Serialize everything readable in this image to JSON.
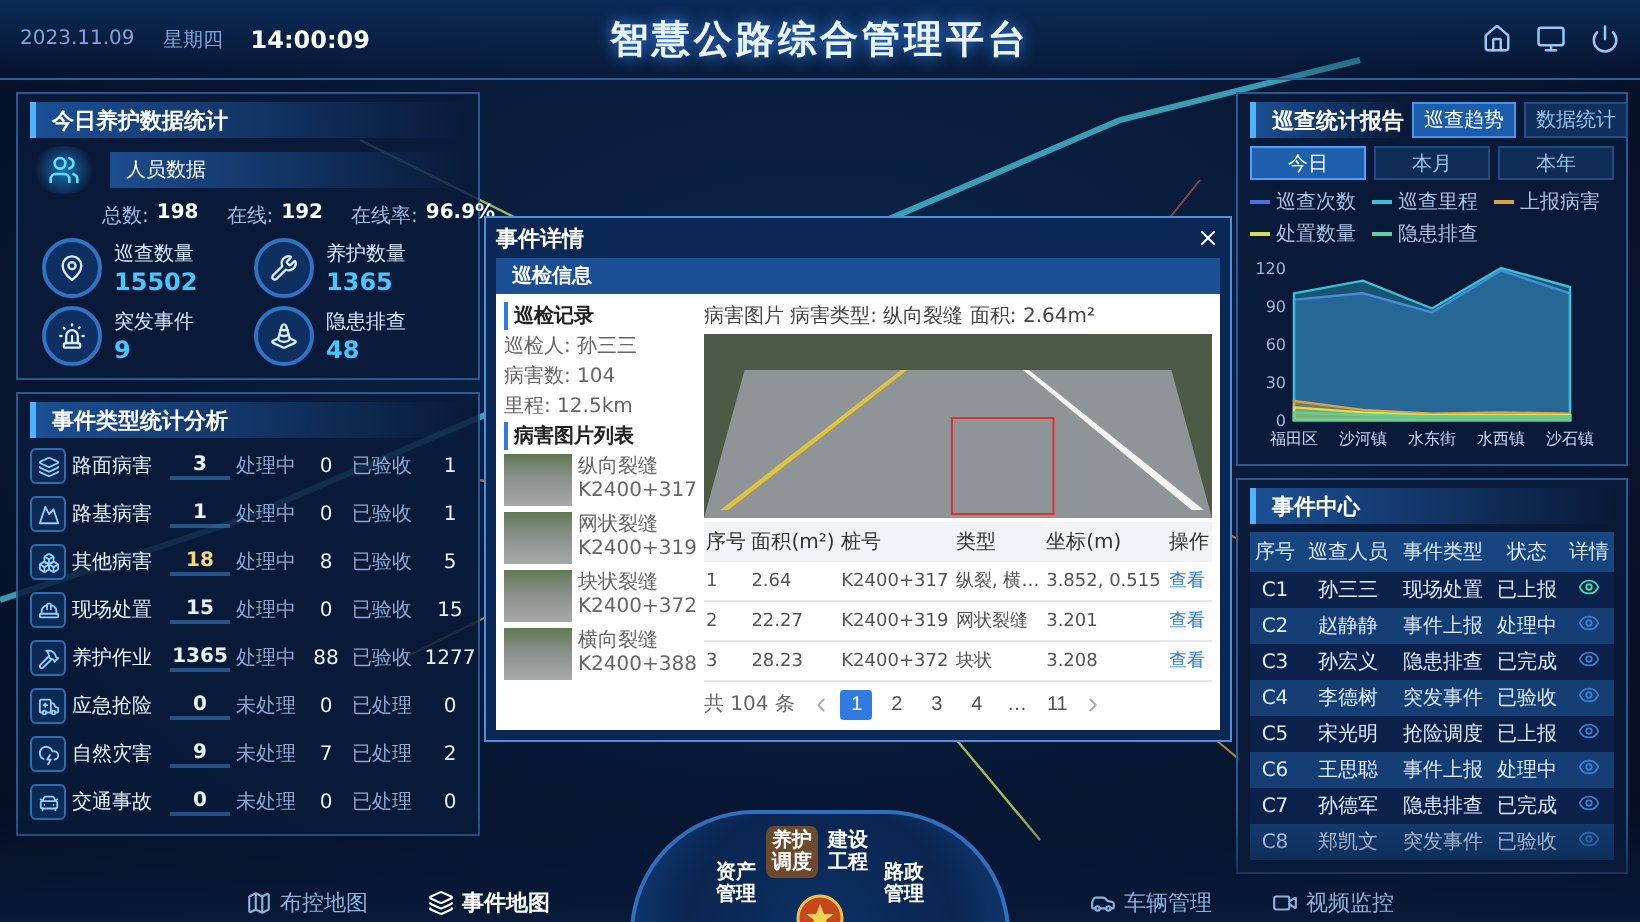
{
  "header": {
    "date": "2023.11.09",
    "weekday": "星期四",
    "time": "14:00:09",
    "title": "智慧公路综合管理平台"
  },
  "daily_stats": {
    "title": "今日养护数据统计",
    "personnel": {
      "label": "人员数据",
      "stats": [
        {
          "label": "总数:",
          "value": "198"
        },
        {
          "label": "在线:",
          "value": "192"
        },
        {
          "label": "在线率:",
          "value": "96.9%"
        }
      ]
    },
    "metrics": [
      {
        "kind": "patrol",
        "label": "巡查数量",
        "value": "15502"
      },
      {
        "kind": "maintenance",
        "label": "养护数量",
        "value": "1365"
      },
      {
        "kind": "incident",
        "label": "突发事件",
        "value": "9"
      },
      {
        "kind": "hazard",
        "label": "隐患排查",
        "value": "48"
      }
    ]
  },
  "event_types": {
    "title": "事件类型统计分析",
    "rows": [
      {
        "kind": "pavement",
        "name": "路面病害",
        "count": "3",
        "pending_label": "处理中",
        "pending": "0",
        "done_label": "已验收",
        "done": "1"
      },
      {
        "kind": "subgrade",
        "name": "路基病害",
        "count": "1",
        "pending_label": "处理中",
        "pending": "0",
        "done_label": "已验收",
        "done": "1"
      },
      {
        "kind": "other",
        "name": "其他病害",
        "count": "18",
        "pending_label": "处理中",
        "pending": "8",
        "done_label": "已验收",
        "done": "5"
      },
      {
        "kind": "onsite",
        "name": "现场处置",
        "count": "15",
        "pending_label": "处理中",
        "pending": "0",
        "done_label": "已验收",
        "done": "15"
      },
      {
        "kind": "maintenance",
        "name": "养护作业",
        "count": "1365",
        "pending_label": "处理中",
        "pending": "88",
        "done_label": "已验收",
        "done": "1277"
      },
      {
        "kind": "emergency",
        "name": "应急抢险",
        "count": "0",
        "pending_label": "未处理",
        "pending": "0",
        "done_label": "已处理",
        "done": "0"
      },
      {
        "kind": "disaster",
        "name": "自然灾害",
        "count": "9",
        "pending_label": "未处理",
        "pending": "7",
        "done_label": "已处理",
        "done": "2"
      },
      {
        "kind": "accident",
        "name": "交通事故",
        "count": "0",
        "pending_label": "未处理",
        "pending": "0",
        "done_label": "已处理",
        "done": "0"
      }
    ]
  },
  "modal": {
    "title": "事件详情",
    "tab": "巡检信息",
    "info_title": "巡检记录",
    "info": [
      "巡检人: 孙三三",
      "病害数: 104",
      "里程: 12.5km"
    ],
    "list_title": "病害图片列表",
    "thumbnails": [
      {
        "type": "纵向裂缝",
        "station": "K2400+317"
      },
      {
        "type": "网状裂缝",
        "station": "K2400+319"
      },
      {
        "type": "块状裂缝",
        "station": "K2400+372"
      },
      {
        "type": "横向裂缝",
        "station": "K2400+388"
      }
    ],
    "caption": "病害图片  病害类型: 纵向裂缝  面积: 2.64m²",
    "table": {
      "columns": [
        "序号",
        "面积(m²)",
        "桩号",
        "类型",
        "坐标(m)",
        "操作"
      ],
      "rows": [
        [
          "1",
          "2.64",
          "K2400+317",
          "纵裂, 横…",
          "3.852, 0.515",
          "查看"
        ],
        [
          "2",
          "22.27",
          "K2400+319",
          "网状裂缝",
          "3.201",
          "查看"
        ],
        [
          "3",
          "28.23",
          "K2400+372",
          "块状",
          "3.208",
          "查看"
        ]
      ]
    },
    "pagination": {
      "total": "共 104 条",
      "pages": [
        {
          "label": "1",
          "selected": true
        },
        {
          "label": "2",
          "selected": false
        },
        {
          "label": "3",
          "selected": false
        },
        {
          "label": "4",
          "selected": false
        },
        {
          "label": "…",
          "selected": false
        },
        {
          "label": "11",
          "selected": false
        }
      ]
    }
  },
  "patrol_report": {
    "title": "巡查统计报告",
    "buttons": [
      {
        "label": "巡查趋势",
        "selected": true
      },
      {
        "label": "数据统计",
        "selected": false
      }
    ],
    "tabs": [
      {
        "label": "今日",
        "selected": true
      },
      {
        "label": "本月",
        "selected": false
      },
      {
        "label": "本年",
        "selected": false
      }
    ],
    "chart_data": {
      "type": "area",
      "categories": [
        "福田区",
        "沙河镇",
        "水东街",
        "水西镇",
        "沙石镇"
      ],
      "ylim": [
        0,
        120
      ],
      "yticks": [
        0,
        30,
        60,
        90,
        120
      ],
      "series": [
        {
          "name": "巡查次数",
          "color": "#4a6fe0",
          "values": [
            95,
            100,
            85,
            118,
            100
          ]
        },
        {
          "name": "巡查里程",
          "color": "#36c2d8",
          "values": [
            100,
            110,
            88,
            120,
            105
          ]
        },
        {
          "name": "上报病害",
          "color": "#e0a040",
          "values": [
            15,
            8,
            5,
            6,
            5
          ]
        },
        {
          "name": "处置数量",
          "color": "#d8e04a",
          "values": [
            10,
            6,
            4,
            4,
            4
          ]
        },
        {
          "name": "隐患排查",
          "color": "#5fd0a0",
          "values": [
            6,
            4,
            3,
            3,
            3
          ]
        }
      ]
    }
  },
  "event_center": {
    "title": "事件中心",
    "columns": [
      "序号",
      "巡查人员",
      "事件类型",
      "状态",
      "详情"
    ],
    "rows": [
      {
        "id": "C1",
        "person": "孙三三",
        "type": "现场处置",
        "status": "已上报",
        "selected": true
      },
      {
        "id": "C2",
        "person": "赵静静",
        "type": "事件上报",
        "status": "处理中",
        "selected": false
      },
      {
        "id": "C3",
        "person": "孙宏义",
        "type": "隐患排查",
        "status": "已完成",
        "selected": false
      },
      {
        "id": "C4",
        "person": "李德树",
        "type": "突发事件",
        "status": "已验收",
        "selected": false
      },
      {
        "id": "C5",
        "person": "宋光明",
        "type": "抢险调度",
        "status": "已上报",
        "selected": false
      },
      {
        "id": "C6",
        "person": "王思聪",
        "type": "事件上报",
        "status": "处理中",
        "selected": false
      },
      {
        "id": "C7",
        "person": "孙德军",
        "type": "隐患排查",
        "status": "已完成",
        "selected": false
      },
      {
        "id": "C8",
        "person": "郑凯文",
        "type": "突发事件",
        "status": "已验收",
        "selected": false
      }
    ]
  },
  "bottom_nav": {
    "left": [
      {
        "kind": "control_map",
        "label": "布控地图",
        "selected": false
      },
      {
        "kind": "event_map",
        "label": "事件地图",
        "selected": true
      }
    ],
    "dial": [
      {
        "label": "资产管理",
        "selected": false
      },
      {
        "label": "养护调度",
        "selected": true
      },
      {
        "label": "建设工程",
        "selected": false
      },
      {
        "label": "路政管理",
        "selected": false
      }
    ],
    "right": [
      {
        "kind": "vehicle",
        "label": "车辆管理",
        "selected": false
      },
      {
        "kind": "video",
        "label": "视频监控",
        "selected": false
      }
    ]
  }
}
